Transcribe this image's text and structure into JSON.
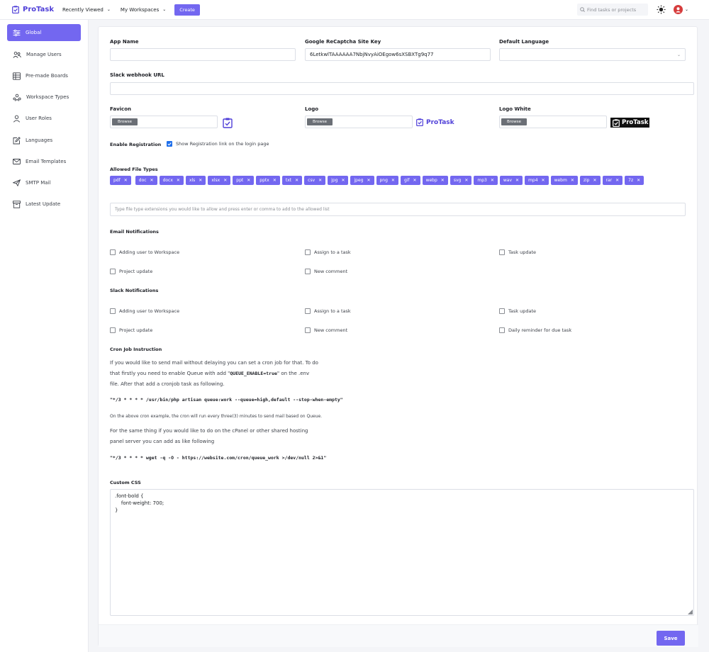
{
  "header": {
    "brand": "ProTask",
    "nav": [
      {
        "label": "Recently Viewed"
      },
      {
        "label": "My Workspaces"
      }
    ],
    "create_label": "Create",
    "search_placeholder": "Find tasks or projects"
  },
  "sidebar": {
    "items": [
      {
        "label": "Global",
        "icon": "sliders-icon",
        "active": true
      },
      {
        "label": "Manage Users",
        "icon": "users-icon"
      },
      {
        "label": "Pre-made Boards",
        "icon": "table-icon"
      },
      {
        "label": "Workspace Types",
        "icon": "workspace-icon"
      },
      {
        "label": "User Roles",
        "icon": "user-icon"
      },
      {
        "label": "Languages",
        "icon": "edit-icon"
      },
      {
        "label": "Email Templates",
        "icon": "mail-icon"
      },
      {
        "label": "SMTP Mail",
        "icon": "send-icon"
      },
      {
        "label": "Latest Update",
        "icon": "archive-icon"
      }
    ]
  },
  "form": {
    "app_name_label": "App Name",
    "app_name_value": "",
    "recaptcha_label": "Google ReCaptcha Site Key",
    "recaptcha_value": "6LetkwlTAAAAAA7NbjNvyAiOEgow6sXSBXTg9q77",
    "language_label": "Default Language",
    "language_value": "",
    "slack_label": "Slack webhook URL",
    "slack_value": "",
    "favicon_label": "Favicon",
    "logo_label": "Logo",
    "logo_white_label": "Logo White",
    "browse_label": "Browse",
    "logo_text": "ProTask",
    "enable_registration_label": "Enable Registration",
    "show_registration_label": "Show Registration link on the login page",
    "allowed_types_label": "Allowed File Types",
    "file_types": [
      "pdf",
      "doc",
      "docx",
      "xls",
      "xlsx",
      "ppt",
      "pptx",
      "txt",
      "csv",
      "jpg",
      "jpeg",
      "png",
      "gif",
      "webp",
      "svg",
      "mp3",
      "wav",
      "mp4",
      "webm",
      "zip",
      "rar",
      "7z"
    ],
    "file_types_placeholder": "Type file type extensions you would like to allow and press enter or comma to add to the allowed list",
    "email_notifications_label": "Email Notifications",
    "email_notifications": [
      {
        "label": "Adding user to Workspace"
      },
      {
        "label": "Assign to a task"
      },
      {
        "label": "Task update"
      },
      {
        "label": "Project update"
      },
      {
        "label": "New comment"
      }
    ],
    "slack_notifications_label": "Slack Notifications",
    "slack_notifications": [
      {
        "label": "Adding user to Workspace"
      },
      {
        "label": "Assign to a task"
      },
      {
        "label": "Task update"
      },
      {
        "label": "Project update"
      },
      {
        "label": "New comment"
      },
      {
        "label": "Daily reminder for due task"
      }
    ],
    "cron_label": "Cron Job Instruction",
    "cron_line1": "If you would like to send mail without delaying you can set a cron job for that. To do",
    "cron_line2_a": "that firstly you need to enable Queue with add \"",
    "cron_line2_code": "QUEUE_ENABLE=true",
    "cron_line2_b": "\" on the .env",
    "cron_line3": "file. After that add a cronjob task as following.",
    "cron_cmd1": "\"*/3 * * * * /usr/bin/php artisan queue:work --queue=high,default --stop-when-empty\"",
    "cron_note": "On the above cron example, the cron will run every three(3) minutes to send mail based on Queue.",
    "cron_line4": "For the same thing if you would like to do on the cPanel or other shared hosting",
    "cron_line5": "panel server you can add as like following",
    "cron_cmd2": "\"*/3 * * * * wget -q -O - https://website.com/cron/queue_work >/dev/null 2>&1\"",
    "custom_css_label": "Custom CSS",
    "custom_css_value": ".font-bold {\n    font-weight: 700;\n}",
    "save_label": "Save"
  },
  "colors": {
    "accent": "#7367f0",
    "checkbox": "#1f6feb"
  }
}
